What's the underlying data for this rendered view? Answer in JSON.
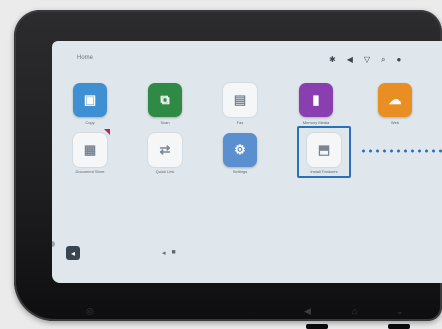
{
  "home": {
    "title": "Home"
  },
  "status": {
    "icons": [
      "✱",
      "◀",
      "▽",
      "⌕",
      "●"
    ]
  },
  "apps": [
    {
      "name": "copy-app",
      "label": "Copy",
      "icon": "▣",
      "color": "#3f8fd3"
    },
    {
      "name": "scan-app",
      "label": "Scan",
      "icon": "⧉",
      "color": "#2f8a46"
    },
    {
      "name": "fax-app",
      "label": "Fax",
      "icon": "▤",
      "color": ""
    },
    {
      "name": "memory-media-app",
      "label": "Memory Media",
      "icon": "▮",
      "color": "#8a3fb0"
    },
    {
      "name": "web-app",
      "label": "Web",
      "icon": "☁",
      "color": "#e98e22"
    },
    {
      "name": "document-store-app",
      "label": "Document Store",
      "icon": "▦",
      "color": ""
    },
    {
      "name": "quick-link-app",
      "label": "Quick Link",
      "icon": "⇄",
      "color": ""
    },
    {
      "name": "settings-app",
      "label": "Settings",
      "icon": "⚙",
      "color": "#5a8fd0"
    },
    {
      "name": "install-features-app",
      "label": "Install Features",
      "icon": "⬒",
      "color": ""
    }
  ],
  "nav": {
    "back_icon": "◂",
    "page_indicator": [
      "◂",
      "■"
    ]
  },
  "hardware": {
    "buttons": [
      "◎",
      "◀",
      "⌂",
      "⌄"
    ]
  }
}
